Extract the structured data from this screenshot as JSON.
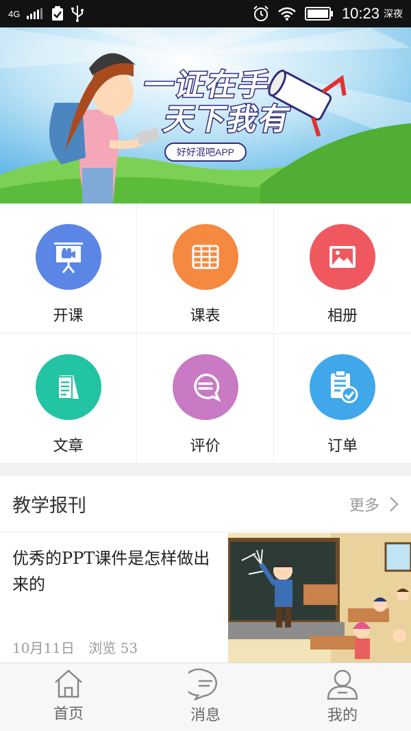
{
  "status_bar": {
    "network": "4G",
    "time": "10:23",
    "mode": "深夜",
    "icons": [
      "signal-icon",
      "clipboard-check-icon",
      "usb-icon",
      "alarm-icon",
      "wifi-icon",
      "battery-icon"
    ]
  },
  "banner": {
    "line1": "一证在手",
    "line2": "天下我有",
    "app_label": "好好混吧APP"
  },
  "grid": {
    "items": [
      {
        "label": "开课",
        "icon": "projector-camera-icon",
        "color": "#5b86e5"
      },
      {
        "label": "课表",
        "icon": "table-icon",
        "color": "#f5893f"
      },
      {
        "label": "相册",
        "icon": "image-icon",
        "color": "#f0585f"
      },
      {
        "label": "文章",
        "icon": "document-icon",
        "color": "#22c4a3"
      },
      {
        "label": "评价",
        "icon": "chat-bubble-icon",
        "color": "#c87ac4"
      },
      {
        "label": "订单",
        "icon": "clipboard-check-icon",
        "color": "#3fa7ea"
      }
    ]
  },
  "section": {
    "title": "教学报刊",
    "more": "更多"
  },
  "article": {
    "title": "优秀的PPT课件是怎样做出来的",
    "date": "10月11日",
    "views": "浏览 53"
  },
  "tabbar": {
    "tabs": [
      {
        "label": "首页",
        "icon": "home-icon"
      },
      {
        "label": "消息",
        "icon": "message-icon"
      },
      {
        "label": "我的",
        "icon": "user-icon"
      }
    ]
  }
}
